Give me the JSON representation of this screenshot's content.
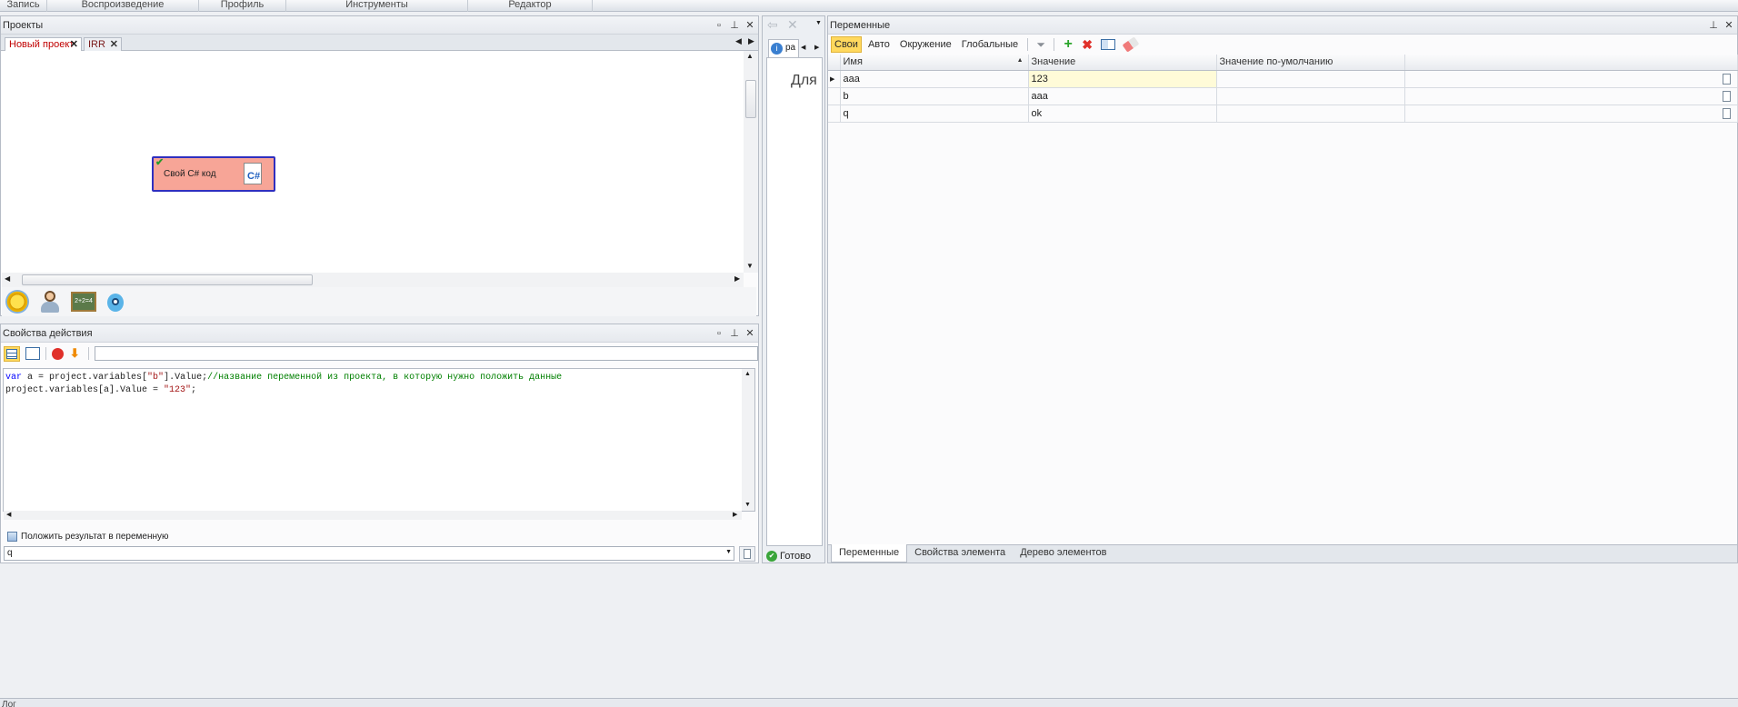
{
  "menu": [
    "Запись",
    "Воспроизведение",
    "Профиль",
    "Инструменты",
    "Редактор"
  ],
  "projects_panel": {
    "title": "Проекты",
    "tabs": [
      {
        "label": "Новый проект",
        "active": true
      },
      {
        "label": "IRR",
        "active": false
      }
    ],
    "node": {
      "label": "Свой C# код"
    }
  },
  "action_props": {
    "title": "Свойства действия",
    "code_lines": [
      [
        {
          "t": "var",
          "c": "kw"
        },
        {
          "t": " a = project.variables[",
          "c": ""
        },
        {
          "t": "\"b\"",
          "c": "st"
        },
        {
          "t": "].Value;",
          "c": ""
        },
        {
          "t": "//название переменной из проекта, в которую нужно положить данные",
          "c": "cm"
        }
      ],
      [
        {
          "t": "project.variables[a].Value = ",
          "c": ""
        },
        {
          "t": "\"123\"",
          "c": "st"
        },
        {
          "t": ";",
          "c": ""
        }
      ]
    ],
    "checkbox_label": "Положить результат в переменную",
    "result_var": "q"
  },
  "browser_panel": {
    "tab_label": "ра",
    "content_text": "Для в",
    "status": "Готово"
  },
  "variables_panel": {
    "title": "Переменные",
    "filters": [
      {
        "label": "Свои",
        "active": true
      },
      {
        "label": "Авто",
        "active": false
      },
      {
        "label": "Окружение",
        "active": false
      },
      {
        "label": "Глобальные",
        "active": false
      }
    ],
    "columns": [
      "Имя",
      "Значение",
      "Значение по-умолчанию"
    ],
    "rows": [
      {
        "name": "aaa",
        "value": "123",
        "default": ""
      },
      {
        "name": "b",
        "value": "aaa",
        "default": ""
      },
      {
        "name": "q",
        "value": "ok",
        "default": ""
      }
    ],
    "bottom_tabs": [
      {
        "label": "Переменные",
        "active": true
      },
      {
        "label": "Свойства элемента",
        "active": false
      },
      {
        "label": "Дерево элементов",
        "active": false
      }
    ]
  },
  "bottom_panel": {
    "title": "Лог"
  },
  "colors": {
    "accent": "#ffd95e",
    "node_fill": "#f7a597",
    "node_border": "#2f2fbf",
    "active_tab_text": "#c00000"
  }
}
